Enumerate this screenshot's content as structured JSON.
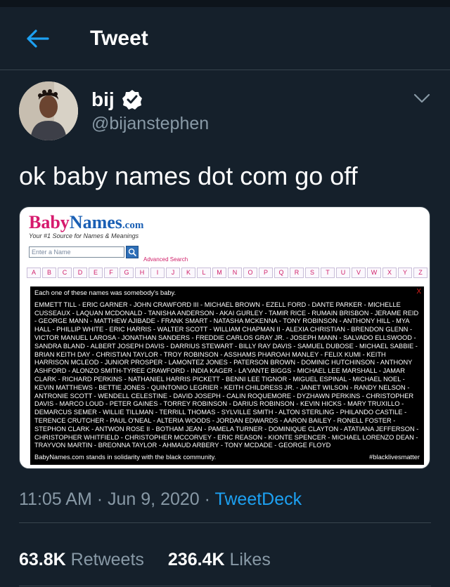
{
  "header": {
    "title": "Tweet"
  },
  "author": {
    "name": "bij",
    "handle": "@bijanstephen"
  },
  "tweet": {
    "text": "ok baby names dot com go off"
  },
  "media": {
    "logo": {
      "baby": "Baby",
      "names": "Names",
      "com": ".com"
    },
    "tagline": "Your #1 Source for Names & Meanings",
    "search_placeholder": "Enter a Name",
    "advanced_search": "Advanced Search",
    "letters": [
      "A",
      "B",
      "C",
      "D",
      "E",
      "F",
      "G",
      "H",
      "I",
      "J",
      "K",
      "L",
      "M",
      "N",
      "O",
      "P",
      "Q",
      "R",
      "S",
      "T",
      "U",
      "V",
      "W",
      "X",
      "Y",
      "Z"
    ],
    "panel": {
      "close": "X",
      "heading": "Each one of these names was somebody's baby.",
      "names": "EMMETT TILL - ERIC GARNER - JOHN CRAWFORD III - MICHAEL BROWN - EZELL FORD - DANTE PARKER - MICHELLE CUSSEAUX - LAQUAN MCDONALD - TANISHA ANDERSON - AKAI GURLEY - TAMIR RICE - RUMAIN BRISBON - JERAME REID - GEORGE MANN - MATTHEW AJIBADE - FRANK SMART - NATASHA MCKENNA - TONY ROBINSON - ANTHONY HILL - MYA HALL - PHILLIP WHITE - ERIC HARRIS - WALTER SCOTT - WILLIAM CHAPMAN II - ALEXIA CHRISTIAN - BRENDON GLENN - VICTOR MANUEL LAROSA - JONATHAN SANDERS - FREDDIE CARLOS GRAY JR. - JOSEPH MANN - SALVADO ELLSWOOD - SANDRA BLAND - ALBERT JOSEPH DAVIS - DARRIUS STEWART - BILLY RAY DAVIS - SAMUEL DUBOSE - MICHAEL SABBIE - BRIAN KEITH DAY - CHRISTIAN TAYLOR - TROY ROBINSON - ASSHAMS PHAROAH MANLEY - FELIX KUMI - KEITH HARRISON MCLEOD - JUNIOR PROSPER - LAMONTEZ JONES - PATERSON BROWN - DOMINIC HUTCHINSON - ANTHONY ASHFORD - ALONZO SMITH-TYREE CRAWFORD - INDIA KAGER - LA'VANTE BIGGS - MICHAEL LEE MARSHALL - JAMAR CLARK - RICHARD PERKINS - NATHANIEL HARRIS PICKETT - BENNI LEE TIGNOR - MIGUEL ESPINAL - MICHAEL NOEL - KEVIN MATTHEWS - BETTIE JONES - QUINTONIO LEGRIER - KEITH CHILDRESS JR. - JANET WILSON - RANDY NELSON - ANTRONIE SCOTT - WENDELL CELESTINE - DAVID JOSEPH - CALIN ROQUEMORE - DYZHAWN PERKINS - CHRISTOPHER DAVIS - MARCO LOUD - PETER GAINES - TORREY ROBINSON - DARIUS ROBINSON - KEVIN HICKS - MARY TRUXILLO - DEMARCUS SEMER - WILLIE TILLMAN - TERRILL THOMAS - SYLVILLE SMITH - ALTON STERLING - PHILANDO CASTILE - TERENCE CRUTCHER - PAUL O'NEAL - ALTERIA WOODS - JORDAN EDWARDS - AARON BAILEY - RONELL FOSTER - STEPHON CLARK - ANTWON ROSE II - BOTHAM JEAN - PAMELA TURNER - DOMINIQUE CLAYTON - ATATIANA JEFFERSON - CHRISTOPHER WHITFIELD - CHRISTOPHER MCCORVEY - ERIC REASON - KIONTE SPENCER - MICHAEL LORENZO DEAN - TRAYVON MARTIN - BREONNA TAYLOR - AHMAUD ARBERY - TONY MCDADE - GEORGE FLOYD",
      "footer_left": "BabyNames.com stands in solidarity with the black community.",
      "footer_right": "#blacklivesmatter"
    }
  },
  "meta": {
    "time": "11:05 AM",
    "sep1": "·",
    "date": "Jun 9, 2020",
    "sep2": "·",
    "source": "TweetDeck"
  },
  "stats": {
    "retweets_count": "63.8K",
    "retweets_label": "Retweets",
    "likes_count": "236.4K",
    "likes_label": "Likes"
  },
  "colors": {
    "background": "#15202b",
    "accent": "#1da1f2",
    "muted": "#8899a6"
  }
}
